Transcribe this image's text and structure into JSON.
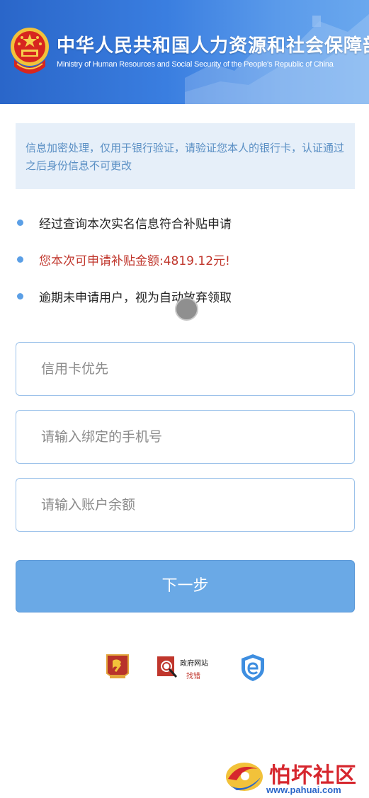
{
  "header": {
    "title_cn": "中华人民共和国人力资源和社会保障部",
    "title_en": "Ministry of Human Resources and Social Security of the People's Republic of China",
    "emblem_icon": "national-emblem-icon"
  },
  "notice": {
    "text": "信息加密处理，仅用于银行验证，请验证您本人的银行卡，认证通过之后身份信息不可更改"
  },
  "bullets": [
    {
      "text": "经过查询本次实名信息符合补贴申请",
      "color": "#222222"
    },
    {
      "text": "您本次可申请补贴金额:4819.12元!",
      "color": "#c0362c"
    },
    {
      "text": "逾期未申请用户，视为自动放弃领取",
      "color": "#222222"
    }
  ],
  "form": {
    "card_placeholder": "信用卡优先",
    "phone_placeholder": "请输入绑定的手机号",
    "balance_placeholder": "请输入账户余额",
    "next_label": "下一步"
  },
  "footer": {
    "logo1_icon": "party-emblem-icon",
    "logo2_line1": "政府网站",
    "logo2_line2": "找错",
    "logo3_icon": "e-shield-icon"
  },
  "watermark": {
    "title": "怕坏社区",
    "url": "www.pahuai.com"
  },
  "colors": {
    "banner_blue": "#2a66c9",
    "button_blue": "#6aa9e6",
    "notice_bg": "#e6eff9",
    "notice_text": "#5a8fc4",
    "bullet_dot": "#5b9fe6",
    "alert_red": "#c0362c"
  }
}
